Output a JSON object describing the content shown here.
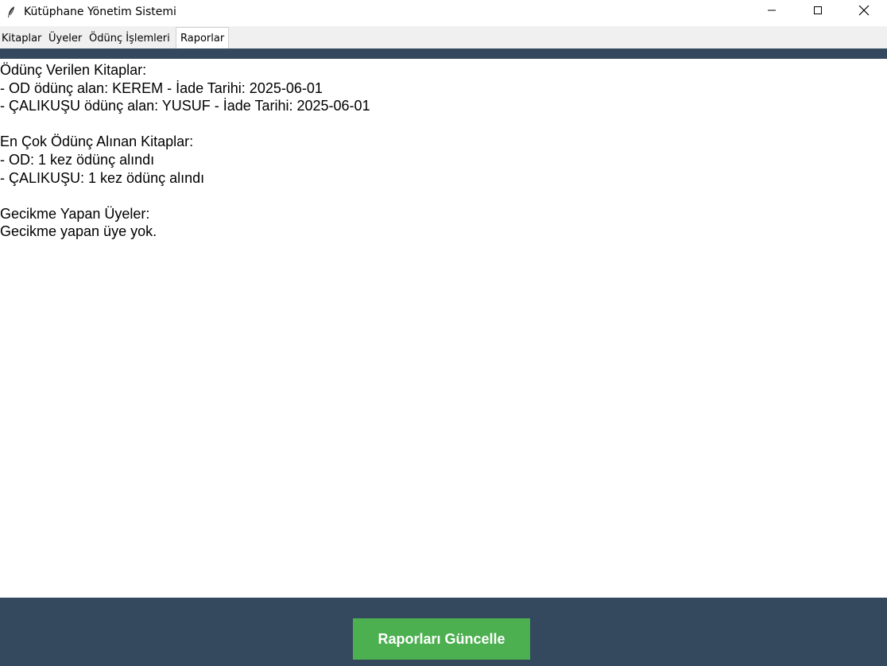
{
  "window": {
    "title": "Kütüphane Yönetim Sistemi",
    "app_icon": "feather-icon",
    "controls": [
      "minimize-icon",
      "maximize-icon",
      "close-icon"
    ]
  },
  "tabs": [
    {
      "label": "Kitaplar",
      "active": false
    },
    {
      "label": "Üyeler",
      "active": false
    },
    {
      "label": "Ödünç İşlemleri",
      "active": false
    },
    {
      "label": "Raporlar",
      "active": true
    }
  ],
  "report": {
    "lines": [
      "Ödünç Verilen Kitaplar:",
      "- OD ödünç alan: KEREM - İade Tarihi: 2025-06-01",
      "- ÇALIKUŞU ödünç alan: YUSUF - İade Tarihi: 2025-06-01",
      "",
      "En Çok Ödünç Alınan Kitaplar:",
      "- OD: 1 kez ödünç alındı",
      "- ÇALIKUŞU: 1 kez ödünç alındı",
      "",
      "Gecikme Yapan Üyeler:",
      "Gecikme yapan üye yok."
    ]
  },
  "footer": {
    "update_button_label": "Raporları Güncelle"
  },
  "colors": {
    "header_bar": "#34495e",
    "footer_bg": "#34495e",
    "button_bg": "#4caf50",
    "button_text": "#ffffff"
  }
}
